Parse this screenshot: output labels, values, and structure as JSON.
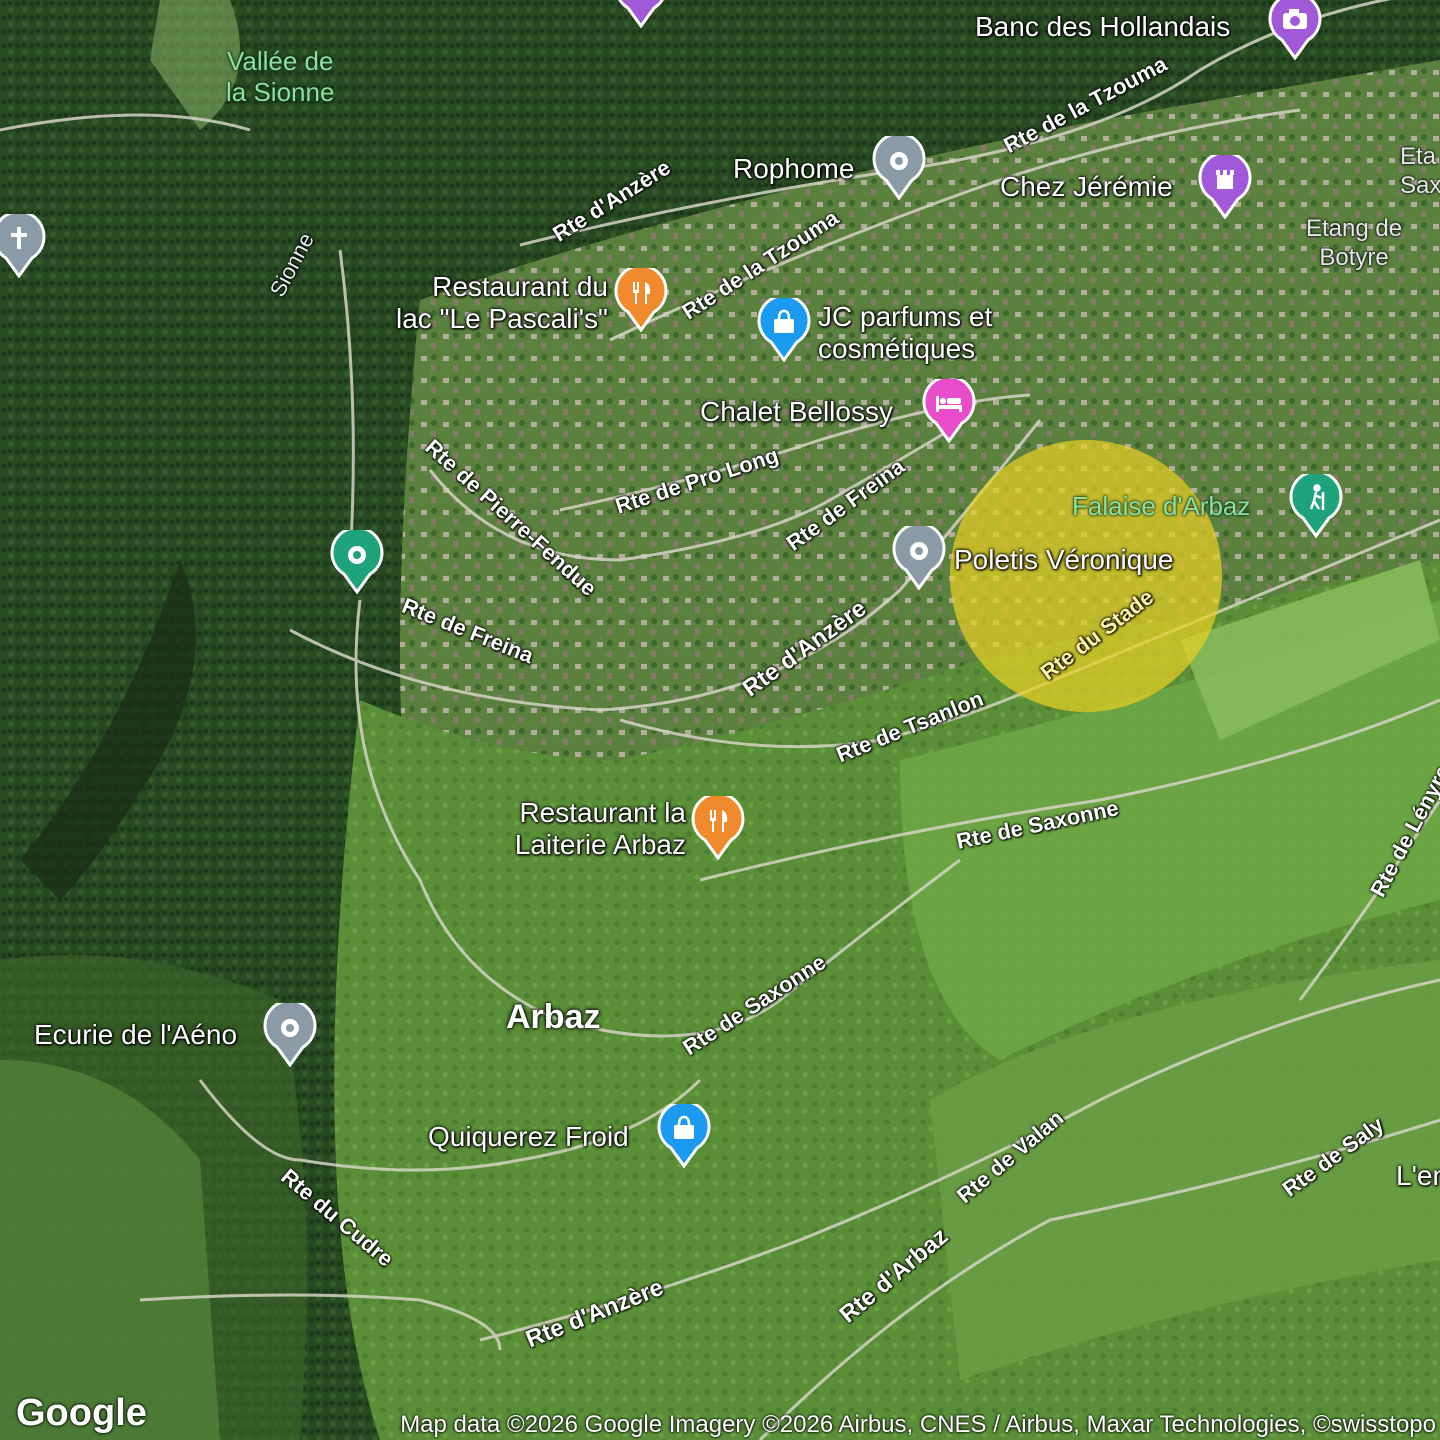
{
  "map": {
    "type": "satellite",
    "colors": {
      "forest": "#274a22",
      "meadow": "#5d9a3a",
      "field": "#78b04c",
      "road": "#d8d8cc",
      "highlight": "#e8cf24"
    }
  },
  "town": {
    "name": "Arbaz"
  },
  "natural_features": {
    "valley": "Vallée de\nla Sionne",
    "river": "Sionne",
    "cliff": "Falaise d'Arbaz",
    "pond": "Etang de\nBotyre",
    "pond_partial": "Eta\nSax"
  },
  "roads": [
    {
      "id": "rte-anzere-north",
      "label": "Rte d'Anzère"
    },
    {
      "id": "rte-tzouma-upper",
      "label": "Rte de la Tzouma"
    },
    {
      "id": "rte-tzouma-lower",
      "label": "Rte de la Tzouma"
    },
    {
      "id": "rte-pro-long",
      "label": "Rte de Pro Long"
    },
    {
      "id": "rte-freina-east",
      "label": "Rte de Freina"
    },
    {
      "id": "rte-pierre-fendue",
      "label": "Rte de Pierre-Fendue"
    },
    {
      "id": "rte-freina-west",
      "label": "Rte de Freina"
    },
    {
      "id": "rte-anzere-mid",
      "label": "Rte d'Anzère"
    },
    {
      "id": "rte-du-stade",
      "label": "Rte du Stade"
    },
    {
      "id": "rte-tsanlon",
      "label": "Rte de Tsanlon"
    },
    {
      "id": "rte-saxonne-east",
      "label": "Rte de Saxonne"
    },
    {
      "id": "rte-saxonne-south",
      "label": "Rte de Saxonne"
    },
    {
      "id": "rte-lenyre",
      "label": "Rte de Lényre"
    },
    {
      "id": "rte-valan",
      "label": "Rte de Valan"
    },
    {
      "id": "rte-saly",
      "label": "Rte de Saly"
    },
    {
      "id": "rte-arbaz",
      "label": "Rte d'Arbaz"
    },
    {
      "id": "rte-cudre",
      "label": "Rte du Cudre"
    },
    {
      "id": "rte-anzere-south",
      "label": "Rte d'Anzère"
    }
  ],
  "places": [
    {
      "id": "banc-des-hollandais",
      "name": "Banc des Hollandais",
      "category": "photo-spot",
      "icon": "camera-icon",
      "color": "#a259d9"
    },
    {
      "id": "rophome",
      "name": "Rophome",
      "category": "place",
      "icon": "location-dot-icon",
      "color": "#8a9aa6"
    },
    {
      "id": "chez-jeremie",
      "name": "Chez Jérémie",
      "category": "landmark",
      "icon": "tower-icon",
      "color": "#a259d9"
    },
    {
      "id": "restaurant-pascalis",
      "name": "Restaurant du\nlac \"Le Pascali's\"",
      "category": "restaurant",
      "icon": "fork-knife-icon",
      "color": "#f08a2c"
    },
    {
      "id": "jc-parfums",
      "name": "JC parfums et\ncosmétiques",
      "category": "shopping",
      "icon": "shopping-bag-icon",
      "color": "#1a9bf0"
    },
    {
      "id": "chalet-bellossy",
      "name": "Chalet Bellossy",
      "category": "lodging",
      "icon": "bed-icon",
      "color": "#e94cc9"
    },
    {
      "id": "falaise-arbaz",
      "name": "Falaise d'Arbaz",
      "category": "hiking",
      "icon": "hiker-icon",
      "color": "#1ea37a"
    },
    {
      "id": "poletis-veronique",
      "name": "Poletis Véronique",
      "category": "place",
      "icon": "location-dot-icon",
      "color": "#8a9aa6"
    },
    {
      "id": "green-poi",
      "name": "",
      "category": "park",
      "icon": "location-dot-icon",
      "color": "#1ea37a"
    },
    {
      "id": "restaurant-laiterie",
      "name": "Restaurant la\nLaiterie Arbaz",
      "category": "restaurant",
      "icon": "fork-knife-icon",
      "color": "#f08a2c"
    },
    {
      "id": "ecurie-aeno",
      "name": "Ecurie de l'Aéno",
      "category": "place",
      "icon": "location-dot-icon",
      "color": "#8a9aa6"
    },
    {
      "id": "quiquerez-froid",
      "name": "Quiquerez Froid",
      "category": "shopping",
      "icon": "shopping-bag-icon",
      "color": "#1a9bf0"
    },
    {
      "id": "church-west",
      "name": "",
      "category": "church",
      "icon": "cross-icon",
      "color": "#8a9aa6"
    },
    {
      "id": "top-purple",
      "name": "",
      "category": "landmark",
      "icon": "tower-icon",
      "color": "#a259d9"
    }
  ],
  "edge_labels": {
    "lenyre_partial": "L'en"
  },
  "branding": {
    "logo": "Google"
  },
  "attribution": "Map data ©2026 Google Imagery ©2026 Airbus, CNES / Airbus, Maxar Technologies, ©swisstopo"
}
